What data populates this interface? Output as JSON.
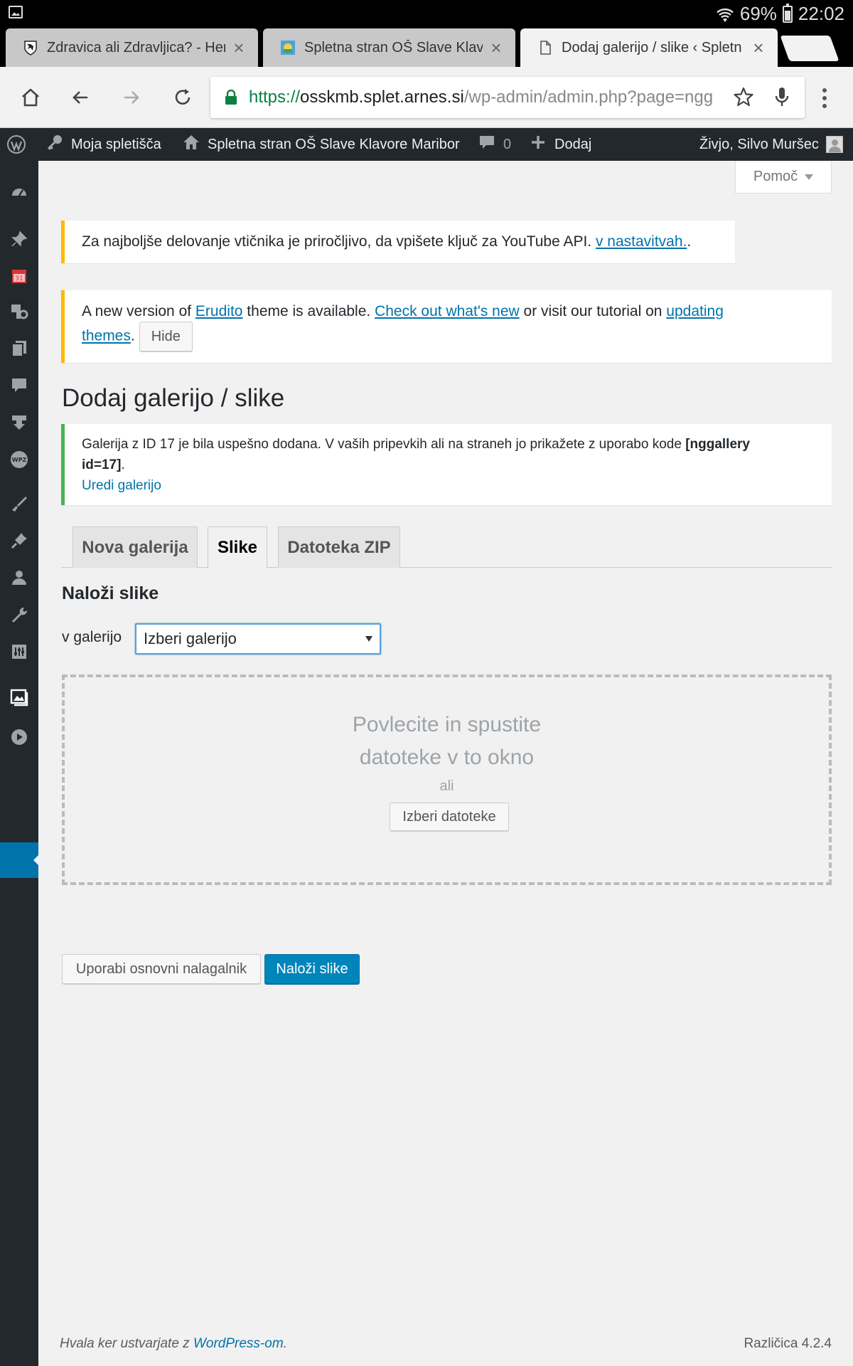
{
  "status_bar": {
    "battery": "69%",
    "time": "22:02",
    "battery_level": 0.69
  },
  "browser": {
    "tabs": [
      {
        "title": "Zdravica ali Zdravljica? - Heri",
        "favicon": "coat-of-arms-icon"
      },
      {
        "title": "Spletna stran OŠ Slave Klavo",
        "favicon": "school-logo-icon"
      },
      {
        "title": "Dodaj galerijo / slike ‹ Spletn",
        "favicon": "page-icon"
      }
    ],
    "url": {
      "scheme": "https://",
      "host": "osskmb.splet.arnes.si",
      "path": "/wp-admin/admin.php?page=ngg"
    }
  },
  "admin_bar": {
    "my_sites": "Moja spletišča",
    "site_name": "Spletna stran OŠ Slave Klavore Maribor",
    "comments_count": "0",
    "add_new": "Dodaj",
    "greeting": "Živjo, Silvo Muršec"
  },
  "sidebar_icons": [
    "dashboard-icon",
    "pin-icon",
    "calendar-icon",
    "media-icon",
    "pages-icon",
    "comments-icon",
    "download-icon",
    "wpz-icon",
    "appearance-icon",
    "plugins-icon",
    "users-icon",
    "tools-icon",
    "settings-icon",
    "gallery-icon",
    "play-icon"
  ],
  "help_button": "Pomoč",
  "youtube_notice": {
    "text": "Za najboljše delovanje vtičnika je priročljivo, da vpišete ključ za YouTube API. ",
    "link": "v nastavitvah.",
    "after": "."
  },
  "theme_notice": {
    "t1": "A new version of ",
    "link1": "Erudito",
    "t2": " theme is available. ",
    "link2": "Check out what's new",
    "t3": " or visit our tutorial on ",
    "link3a": "updating",
    "link3b": "themes",
    "t4": ".",
    "hide": "Hide"
  },
  "page_title": "Dodaj galerijo / slike",
  "success_notice": {
    "text": "Galerija z ID 17 je bila uspešno dodana. V vaših pripevkih ali na straneh jo prikažete z uporabo kode ",
    "code_a": "[nggallery",
    "code_b": "id=17]",
    "after": ".",
    "link": "Uredi galerijo"
  },
  "tabs": [
    "Nova galerija",
    "Slike",
    "Datoteka ZIP"
  ],
  "upload": {
    "heading": "Naloži slike",
    "gallery_label": "v galerijo",
    "gallery_select": "Izberi galerijo",
    "drop_line1": "Povlecite in spustite",
    "drop_line2": "datoteke v to okno",
    "or": "ali",
    "choose_files": "Izberi datoteke",
    "basic_uploader": "Uporabi osnovni nalagalnik",
    "upload_button": "Naloži slike"
  },
  "footer": {
    "thanks": "Hvala ker ustvarjate z ",
    "wp_link": "WordPress-om",
    "dot": ".",
    "version": "Različica 4.2.4"
  },
  "colors": {
    "wp_blue": "#0073aa",
    "notice_warning": "#ffb900",
    "notice_success": "#46b450",
    "admin_dark": "#23282d"
  }
}
